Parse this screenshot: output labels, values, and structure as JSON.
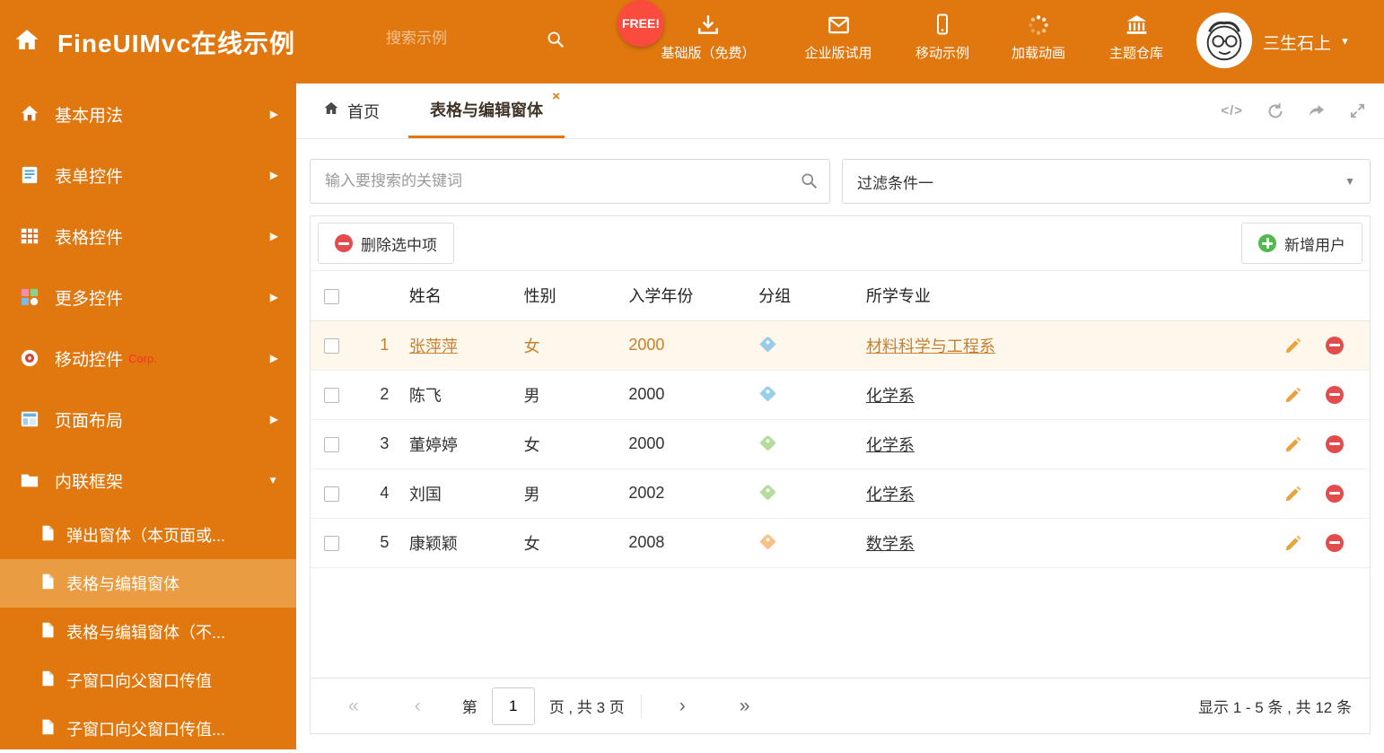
{
  "header": {
    "title": "FineUIMvc在线示例",
    "search_placeholder": "搜索示例",
    "free_badge": "FREE!",
    "nav": [
      {
        "label": "基础版（免费）",
        "icon": "download-icon"
      },
      {
        "label": "企业版试用",
        "icon": "envelope-icon"
      },
      {
        "label": "移动示例",
        "icon": "mobile-icon"
      },
      {
        "label": "加载动画",
        "icon": "spinner-icon"
      },
      {
        "label": "主题仓库",
        "icon": "bank-icon"
      }
    ],
    "user_name": "三生石上"
  },
  "sidebar": {
    "items": [
      {
        "label": "基本用法"
      },
      {
        "label": "表单控件"
      },
      {
        "label": "表格控件"
      },
      {
        "label": "更多控件"
      },
      {
        "label": "移动控件",
        "badge": "Corp."
      },
      {
        "label": "页面布局"
      },
      {
        "label": "内联框架"
      }
    ],
    "subitems": [
      {
        "label": "弹出窗体（本页面或..."
      },
      {
        "label": "表格与编辑窗体"
      },
      {
        "label": "表格与编辑窗体（不..."
      },
      {
        "label": "子窗口向父窗口传值"
      },
      {
        "label": "子窗口向父窗口传值..."
      }
    ]
  },
  "tabs": {
    "home_label": "首页",
    "active_label": "表格与编辑窗体"
  },
  "filters": {
    "search_placeholder": "输入要搜索的关键词",
    "filter_value": "过滤条件一"
  },
  "toolbar": {
    "delete_label": "删除选中项",
    "add_label": "新增用户"
  },
  "grid": {
    "headers": {
      "name": "姓名",
      "gender": "性别",
      "year": "入学年份",
      "group": "分组",
      "major": "所学专业"
    },
    "rows": [
      {
        "num": "1",
        "name": "张萍萍",
        "gender": "女",
        "year": "2000",
        "tag_color": "#7ec1e8",
        "major": "材料科学与工程系"
      },
      {
        "num": "2",
        "name": "陈飞",
        "gender": "男",
        "year": "2000",
        "tag_color": "#7ec1e8",
        "major": "化学系"
      },
      {
        "num": "3",
        "name": "董婷婷",
        "gender": "女",
        "year": "2000",
        "tag_color": "#9fd37e",
        "major": "化学系"
      },
      {
        "num": "4",
        "name": "刘国",
        "gender": "男",
        "year": "2002",
        "tag_color": "#9fd37e",
        "major": "化学系"
      },
      {
        "num": "5",
        "name": "康颖颖",
        "gender": "女",
        "year": "2008",
        "tag_color": "#f5b06a",
        "major": "数学系"
      }
    ]
  },
  "pagination": {
    "page_label_prefix": "第",
    "page_value": "1",
    "page_label_suffix": "页 , 共 3 页",
    "summary": "显示 1 - 5 条 , 共 12 条"
  },
  "glyphs": {
    "close": "×",
    "code": "</>",
    "caret_down": "▼",
    "arrow_right": "▶",
    "first": "«",
    "prev": "‹",
    "next": "›",
    "last": "»"
  },
  "colors": {
    "primary": "#e0780f",
    "sidebar_active_bg": "#ea9c42",
    "selected_row_bg": "#fdf7ec",
    "selected_row_text": "#c8802f",
    "free_badge_bg": "#fb4a3e",
    "delete_icon": "#e24c4c",
    "add_icon": "#52b94e",
    "pencil_icon": "#e8a33d"
  }
}
